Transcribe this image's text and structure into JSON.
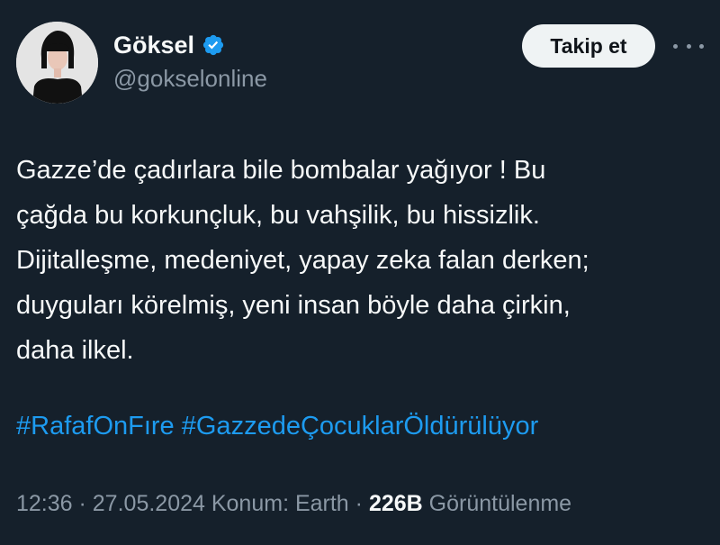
{
  "author": {
    "name": "Göksel",
    "handle": "@gokselonline",
    "verified": true
  },
  "actions": {
    "follow_label": "Takip et",
    "more_icon": "more-horizontal-icon"
  },
  "tweet": {
    "lines": [
      "Gazze’de çadırlara bile bombalar yağıyor ! Bu",
      "çağda bu korkunçluk, bu vahşilik, bu hissizlik.",
      "Dijitalleşme, medeniyet, yapay zeka falan derken;",
      "duyguları körelmiş, yeni insan böyle daha çirkin,",
      "daha ilkel."
    ],
    "hashtags": [
      "#RafafOnFıre",
      "#GazzedeÇocuklarÖldürülüyor"
    ]
  },
  "meta": {
    "time": "12:36",
    "sep1": " · ",
    "date": "27.05.2024",
    "location": " Konum: Earth",
    "sep2": " · ",
    "views_count": "226B",
    "views_label": " Görüntülenme"
  },
  "colors": {
    "background": "#15202b",
    "text": "#f7f9f9",
    "secondary": "#8b98a5",
    "accent": "#1d9bf0",
    "button_bg": "#eff3f4"
  }
}
